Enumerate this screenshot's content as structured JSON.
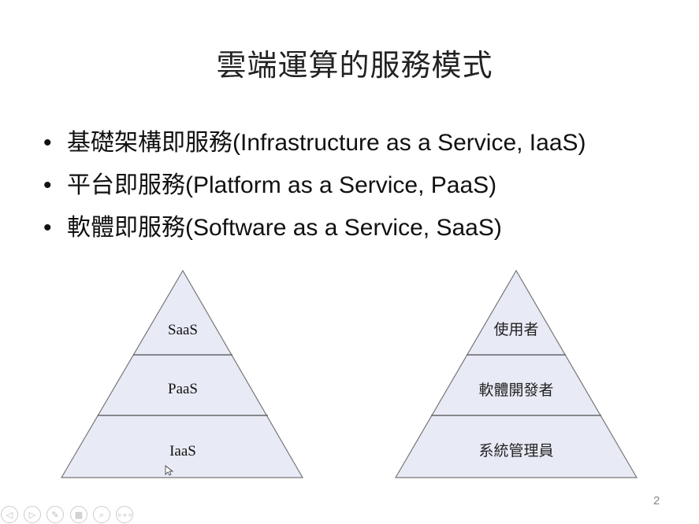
{
  "slide": {
    "title": "雲端運算的服務模式",
    "bullets": [
      "基礎架構即服務(Infrastructure as a Service, IaaS)",
      "平台即服務(Platform as a Service, PaaS)",
      "軟體即服務(Software as a Service, SaaS)"
    ],
    "bullet_symbol": "•",
    "left_pyramid": [
      "SaaS",
      "PaaS",
      "IaaS"
    ],
    "right_pyramid": [
      "使用者",
      "軟體開發者",
      "系統管理員"
    ],
    "page_number": "2"
  },
  "controls": {
    "prev": "◁",
    "next": "▷",
    "pen": "✎",
    "slides": "▦",
    "zoom": "⌕",
    "more": "∘∘∘"
  },
  "colors": {
    "fill": "#e8eaf6",
    "stroke": "#777777"
  }
}
